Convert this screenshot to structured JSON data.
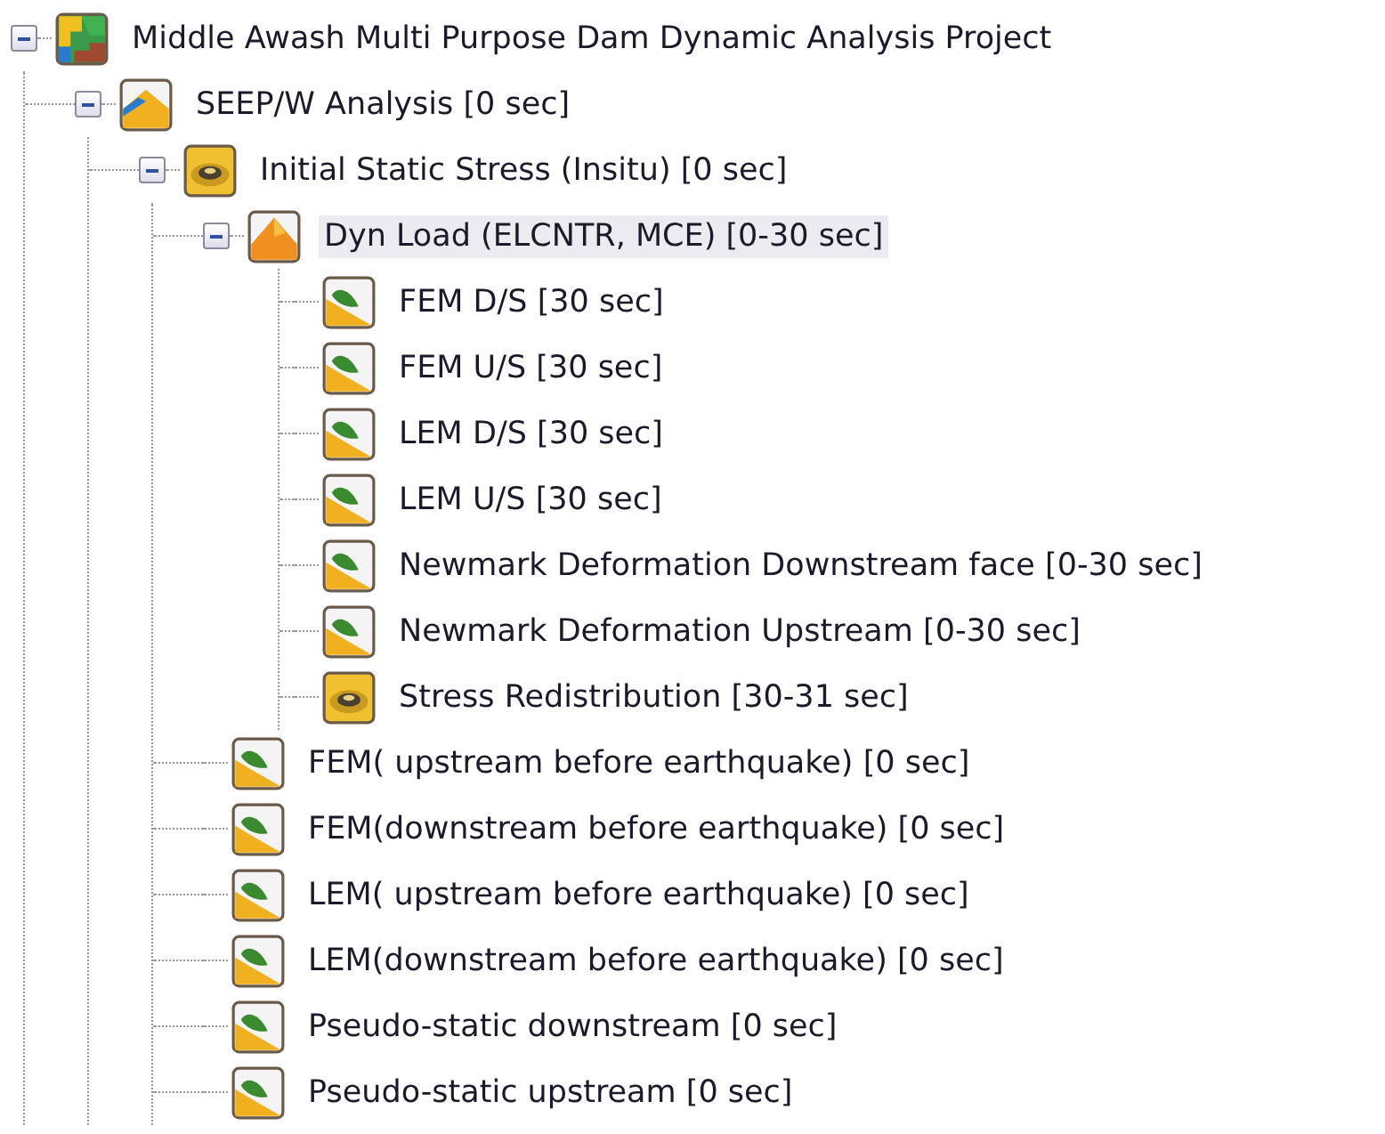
{
  "tree": [
    {
      "label": "Middle Awash Multi Purpose Dam Dynamic Analysis Project",
      "kind": "project",
      "selected": false,
      "expanded": true,
      "children": [
        {
          "label": "SEEP/W Analysis [0 sec]",
          "kind": "seepage",
          "selected": false,
          "expanded": true,
          "children": [
            {
              "label": "Initial Static Stress (Insitu) [0 sec]",
              "kind": "stress",
              "selected": false,
              "expanded": true,
              "children": [
                {
                  "label": "Dyn Load (ELCNTR, MCE) [0-30 sec]",
                  "kind": "dynamic",
                  "selected": true,
                  "expanded": true,
                  "children": [
                    {
                      "label": "FEM D/S [30 sec]",
                      "kind": "slope",
                      "selected": false
                    },
                    {
                      "label": "FEM U/S [30 sec]",
                      "kind": "slope",
                      "selected": false
                    },
                    {
                      "label": "LEM D/S [30 sec]",
                      "kind": "slope",
                      "selected": false
                    },
                    {
                      "label": "LEM U/S [30 sec]",
                      "kind": "slope",
                      "selected": false
                    },
                    {
                      "label": "Newmark Deformation Downstream face [0-30 sec]",
                      "kind": "slope",
                      "selected": false
                    },
                    {
                      "label": "Newmark Deformation Upstream [0-30 sec]",
                      "kind": "slope",
                      "selected": false
                    },
                    {
                      "label": "Stress Redistribution [30-31 sec]",
                      "kind": "stress",
                      "selected": false
                    }
                  ]
                },
                {
                  "label": "FEM( upstream before earthquake) [0 sec]",
                  "kind": "slope",
                  "selected": false
                },
                {
                  "label": "FEM(downstream before earthquake) [0 sec]",
                  "kind": "slope",
                  "selected": false
                },
                {
                  "label": "LEM( upstream before earthquake) [0 sec]",
                  "kind": "slope",
                  "selected": false
                },
                {
                  "label": "LEM(downstream before earthquake) [0 sec]",
                  "kind": "slope",
                  "selected": false
                },
                {
                  "label": "Pseudo-static downstream [0 sec]",
                  "kind": "slope",
                  "selected": false
                },
                {
                  "label": "Pseudo-static upstream [0 sec]",
                  "kind": "slope",
                  "selected": false
                }
              ]
            }
          ]
        }
      ]
    }
  ]
}
